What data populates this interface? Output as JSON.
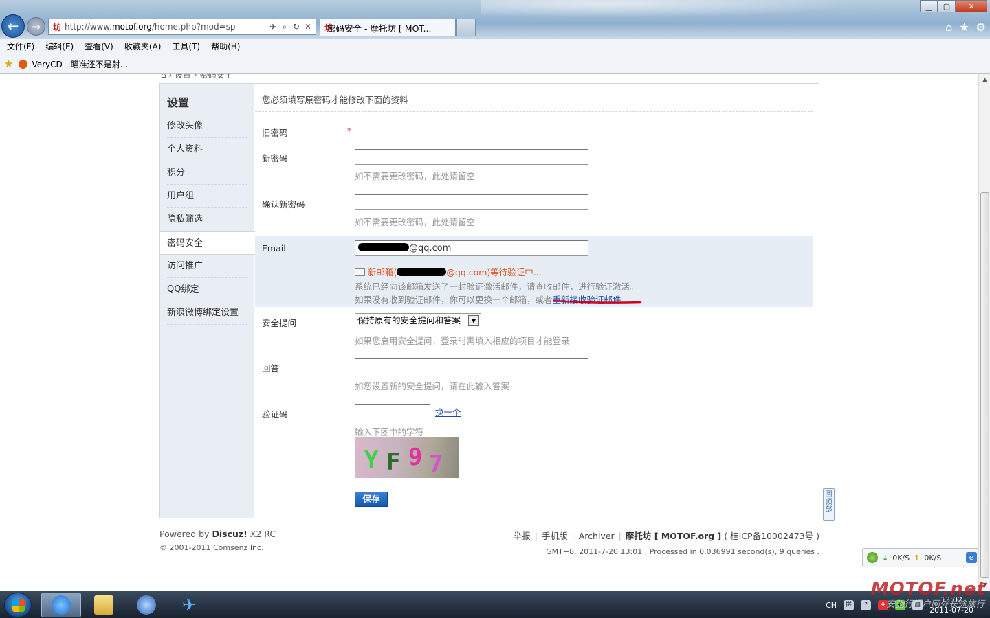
{
  "browser": {
    "address_url_prefix": "http://www.",
    "address_url_domain": "motof.org",
    "address_url_suffix": "/home.php?mod=sp",
    "favicon": "坊",
    "tab_title": "密码安全 - 摩托坊 [ MOT...",
    "tab_close": "×",
    "menu": [
      "文件(F)",
      "编辑(E)",
      "查看(V)",
      "收藏夹(A)",
      "工具(T)",
      "帮助(H)"
    ],
    "favorites_item": "VeryCD - 瞄准还不是射...",
    "window_controls": {
      "minimize": "▁",
      "maximize": "▢",
      "close": "✕"
    }
  },
  "sidebar": {
    "title": "设置",
    "items": [
      {
        "label": "修改头像"
      },
      {
        "label": "个人资料"
      },
      {
        "label": "积分"
      },
      {
        "label": "用户组"
      },
      {
        "label": "隐私筛选"
      },
      {
        "label": "密码安全",
        "active": true
      },
      {
        "label": "访问推广"
      },
      {
        "label": "QQ绑定"
      },
      {
        "label": "新浪微博绑定设置"
      }
    ]
  },
  "form": {
    "notice": "您必须填写原密码才能修改下面的资料",
    "old_password": {
      "label": "旧密码",
      "required_mark": "*",
      "value": ""
    },
    "new_password": {
      "label": "新密码",
      "value": "",
      "hint": "如不需要更改密码，此处请留空"
    },
    "confirm_password": {
      "label": "确认新密码",
      "value": "",
      "hint": "如不需要更改密码，此处请留空"
    },
    "email": {
      "label": "Email",
      "value_visible": "@qq.com",
      "pending_prefix": "新邮箱(",
      "pending_suffix": "@qq.com)等待验证中...",
      "sent_notice": "系统已经向该邮箱发送了一封验证激活邮件，请查收邮件，进行验证激活。",
      "resend_prefix": "如果没有收到验证邮件，你可以更换一个邮箱，或者",
      "resend_link": "重新接收验证邮件"
    },
    "security_question": {
      "label": "安全提问",
      "selected": "保持原有的安全提问和答案",
      "hint": "如果您启用安全提问，登录时需填入相应的项目才能登录"
    },
    "answer": {
      "label": "回答",
      "value": "",
      "hint": "如您设置新的安全提问，请在此输入答案"
    },
    "captcha": {
      "label": "验证码",
      "value": "",
      "refresh_link": "换一个",
      "hint": "输入下图中的字符",
      "chars": [
        "Y",
        "F",
        "9",
        "7"
      ]
    },
    "save_label": "保存"
  },
  "back_to_top": "回顶部",
  "footer": {
    "powered_prefix": "Powered by ",
    "powered_product": "Discuz!",
    "powered_version": " X2 RC",
    "copyright": "© 2001-2011 Comsenz Inc.",
    "links": [
      "举报",
      "手机版",
      "Archiver"
    ],
    "site_name": "摩托坊 [ MOTOF.org ]",
    "icp": "( 桂ICP备10002473号 )",
    "meta": "GMT+8, 2011-7-20 13:01 , Processed in 0.036991 second(s), 9 queries ."
  },
  "speed_widget": {
    "down": "0K/S",
    "up": "0K/S"
  },
  "taskbar": {
    "tray_lang": "CH",
    "clock_time": "13:02",
    "clock_date": "2011-07-20"
  },
  "watermark": {
    "brand": "MOTOF.net",
    "slogan": "安驰行门户网外长途旅行"
  }
}
